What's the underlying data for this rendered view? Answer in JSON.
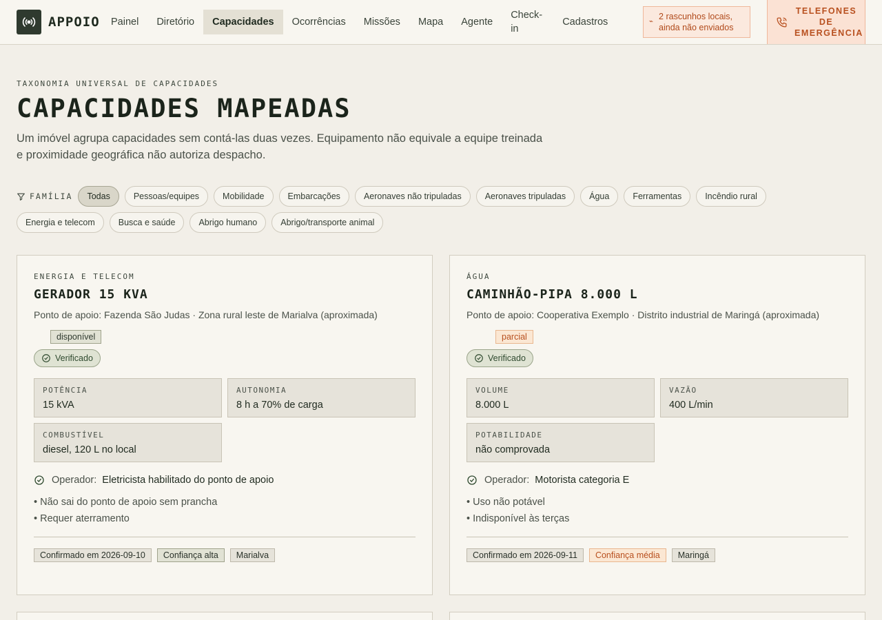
{
  "header": {
    "brand": "APPOIO",
    "nav": [
      {
        "label": "Painel",
        "active": false
      },
      {
        "label": "Diretório",
        "active": false
      },
      {
        "label": "Capacidades",
        "active": true
      },
      {
        "label": "Ocorrências",
        "active": false
      },
      {
        "label": "Missões",
        "active": false
      },
      {
        "label": "Mapa",
        "active": false
      },
      {
        "label": "Agente",
        "active": false
      },
      {
        "label": "Check-in",
        "active": false
      },
      {
        "label": "Cadastros",
        "active": false
      }
    ],
    "drafts_notice": "2 rascunhos locais, ainda não enviados",
    "emergency_label": "TELEFONES DE EMERGÊNCIA",
    "accent_color": "#b8501f"
  },
  "hero": {
    "eyebrow": "TAXONOMIA UNIVERSAL DE CAPACIDADES",
    "title": "CAPACIDADES MAPEADAS",
    "description": "Um imóvel agrupa capacidades sem contá-las duas vezes. Equipamento não equivale a equipe treinada e proximidade geográfica não autoriza despacho."
  },
  "filters": {
    "label": "FAMÍLIA",
    "chips": [
      {
        "label": "Todas",
        "active": true
      },
      {
        "label": "Pessoas/equipes",
        "active": false
      },
      {
        "label": "Mobilidade",
        "active": false
      },
      {
        "label": "Embarcações",
        "active": false
      },
      {
        "label": "Aeronaves não tripuladas",
        "active": false
      },
      {
        "label": "Aeronaves tripuladas",
        "active": false
      },
      {
        "label": "Água",
        "active": false
      },
      {
        "label": "Ferramentas",
        "active": false
      },
      {
        "label": "Incêndio rural",
        "active": false
      },
      {
        "label": "Energia e telecom",
        "active": false
      },
      {
        "label": "Busca e saúde",
        "active": false
      },
      {
        "label": "Abrigo humano",
        "active": false
      },
      {
        "label": "Abrigo/transporte animal",
        "active": false
      }
    ]
  },
  "cards": [
    {
      "family": "ENERGIA E TELECOM",
      "title": "GERADOR 15 KVA",
      "location": "Ponto de apoio: Fazenda São Judas · Zona rural leste de Marialva (aproximada)",
      "status": "disponível",
      "verified": "Verificado",
      "specs": [
        {
          "key": "POTÊNCIA",
          "value": "15 kVA"
        },
        {
          "key": "AUTONOMIA",
          "value": "8 h a 70% de carga"
        },
        {
          "key": "COMBUSTÍVEL",
          "value": "diesel, 120 L no local"
        }
      ],
      "operator_label": "Operador:",
      "operator_value": "Eletricista habilitado do ponto de apoio",
      "notes": [
        "• Não sai do ponto de apoio sem prancha",
        "• Requer aterramento"
      ],
      "tags": [
        "Confirmado em 2026-09-10",
        "Confiança alta",
        "Marialva"
      ]
    },
    {
      "family": "ÁGUA",
      "title": "CAMINHÃO-PIPA 8.000 L",
      "location": "Ponto de apoio: Cooperativa Exemplo · Distrito industrial de Maringá (aproximada)",
      "status": "parcial",
      "verified": "Verificado",
      "specs": [
        {
          "key": "VOLUME",
          "value": "8.000 L"
        },
        {
          "key": "VAZÃO",
          "value": "400 L/min"
        },
        {
          "key": "POTABILIDADE",
          "value": "não comprovada"
        }
      ],
      "operator_label": "Operador:",
      "operator_value": "Motorista categoria E",
      "notes": [
        "• Uso não potável",
        "• Indisponível às terças"
      ],
      "tags": [
        "Confirmado em 2026-09-11",
        "Confiança média",
        "Maringá"
      ]
    }
  ]
}
